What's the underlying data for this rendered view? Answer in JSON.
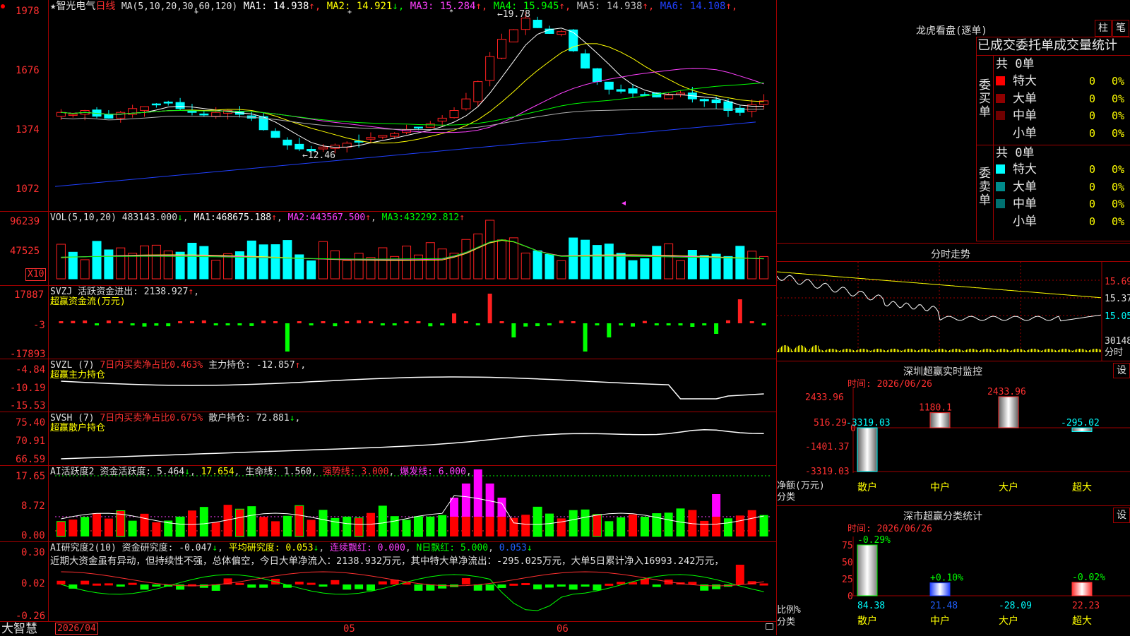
{
  "header": {
    "star": "★",
    "stock_name": "智光电气",
    "period": "日线",
    "ma_params": "MA(5,10,20,30,60,120)",
    "ma": [
      {
        "label": "MA1:",
        "value": "14.938",
        "arrow": "↑",
        "color": "#ffffff"
      },
      {
        "label": "MA2:",
        "value": "14.921",
        "arrow": "↓",
        "color": "#ffff00"
      },
      {
        "label": "MA3:",
        "value": "15.284",
        "arrow": "↑",
        "color": "#ff40ff"
      },
      {
        "label": "MA4:",
        "value": "15.945",
        "arrow": "↑",
        "color": "#00ff00"
      },
      {
        "label": "MA5:",
        "value": "14.938",
        "arrow": "↑",
        "color": "#c0c0c0"
      },
      {
        "label": "MA6:",
        "value": "14.108",
        "arrow": "↑",
        "color": "#2040ff"
      }
    ]
  },
  "price_axis": [
    "1978",
    "1676",
    "1374",
    "1072"
  ],
  "price_annotations": {
    "high": "19.78",
    "low": "12.46"
  },
  "vol": {
    "params": "VOL(5,10,20)",
    "value": "483143.000",
    "value_arrow": "↓",
    "ma1_label": "MA1:",
    "ma1": "468675.188",
    "ma1_arrow": "↑",
    "ma2_label": "MA2:",
    "ma2": "443567.500",
    "ma2_arrow": "↑",
    "ma3_label": "MA3:",
    "ma3": "432292.812",
    "ma3_arrow": "↑",
    "axis": [
      "96239",
      "47525"
    ],
    "unit": "X10"
  },
  "svzj": {
    "name": "SVZJ",
    "label": "活跃资金进出:",
    "value": "2138.927",
    "arrow": "↑",
    "subtitle": "超赢资金流(万元)",
    "axis": [
      "17887",
      "-3",
      "-17893"
    ]
  },
  "svzl": {
    "name": "SVZL (7)",
    "desc": "7日内买卖净占比0.463%",
    "label": "主力持仓:",
    "value": "-12.857",
    "arrow": "↑",
    "tail": ",",
    "subtitle": "超赢主力持仓",
    "axis": [
      "-4.84",
      "-10.19",
      "-15.53"
    ]
  },
  "svsh": {
    "name": "SVSH (7)",
    "desc": "7日内买卖净占比0.675%",
    "label": "散户持仓:",
    "value": "72.881",
    "arrow": "↓",
    "tail": ",",
    "subtitle": "超赢散户持仓",
    "axis": [
      "75.40",
      "70.91",
      "66.59"
    ]
  },
  "ai_active": {
    "name": "AI活跃度2",
    "label": "资金活跃度:",
    "value": "5.464",
    "v2": "17.654",
    "life_label": "生命线:",
    "life": "1.560",
    "strong": "强势线: 3.000",
    "burst": "爆发线: 6.000",
    "axis": [
      "17.65",
      "8.72",
      "0.00"
    ]
  },
  "ai_research": {
    "name": "AI研究度2(10)",
    "label": "资金研究度:",
    "value": "-0.047",
    "avg": "平均研究度: 0.053",
    "lianxu": "连续飘红: 0.000",
    "nday": "N日飘红: 5.000",
    "last": "0.053",
    "comment": "近期大资金虽有异动，但持续性不强，总体偏空，今日大单净流入：2138.932万元，其中特大单净流出：-295.025万元，大单5日累计净入16993.242万元，",
    "axis": [
      "0.30",
      "0.02",
      "-0.26"
    ]
  },
  "date_axis": {
    "brand": "大智慧",
    "start": "2026/04",
    "m05": "05",
    "m06": "06"
  },
  "right": {
    "lhb_title": "龙虎看盘(逐单)",
    "btn_zhu": "柱",
    "btn_bi": "笔",
    "stats_title": "已成交委托单成交量统计",
    "buy_label": "委买单",
    "sell_label": "委卖单",
    "total": "共 0单",
    "buy_rows": [
      {
        "name": "特大",
        "count": "0",
        "pct": "0%",
        "color": "#ff0000"
      },
      {
        "name": "大单",
        "count": "0",
        "pct": "0%",
        "color": "#900000"
      },
      {
        "name": "中单",
        "count": "0",
        "pct": "0%",
        "color": "#700000"
      },
      {
        "name": "小单",
        "count": "0",
        "pct": "0%",
        "color": ""
      }
    ],
    "sell_rows": [
      {
        "name": "特大",
        "count": "0",
        "pct": "0%",
        "color": "#00ffff"
      },
      {
        "name": "大单",
        "count": "0",
        "pct": "0%",
        "color": "#008b8b"
      },
      {
        "name": "中单",
        "count": "0",
        "pct": "0%",
        "color": "#007070"
      },
      {
        "name": "小单",
        "count": "0",
        "pct": "0%",
        "color": ""
      }
    ],
    "intraday_title": "分时走势",
    "intraday_axis": [
      "15.69",
      "15.37",
      "15.05",
      "30148",
      "分时"
    ],
    "sz_monitor_title": "深圳超赢实时监控",
    "sz_set": "设",
    "sz_time": "时间: 2026/06/26",
    "sz_axis": [
      "2433.96",
      "516.29",
      "0",
      "-1401.37",
      "-3319.03"
    ],
    "sz_ylabel": "净额(万元)",
    "sz_xlabel": "分类",
    "sz_bars": [
      {
        "cat": "散户",
        "value": "-3319.03"
      },
      {
        "cat": "中户",
        "value": "1180.1"
      },
      {
        "cat": "大户",
        "value": "2433.96"
      },
      {
        "cat": "超大",
        "value": "-295.02"
      }
    ],
    "cls_title": "深市超赢分类统计",
    "cls_set": "设",
    "cls_time": "时间: 2026/06/26",
    "cls_axis": [
      "75",
      "50",
      "25",
      "0"
    ],
    "cls_ylabel": "比例%",
    "cls_xlabel": "分类",
    "cls_bars": [
      {
        "cat": "散户",
        "top": "-0.29%",
        "bottom": "84.38"
      },
      {
        "cat": "中户",
        "top": "+0.10%",
        "bottom": "21.48"
      },
      {
        "cat": "大户",
        "top": "",
        "bottom": "-28.09"
      },
      {
        "cat": "超大",
        "top": "-0.02%",
        "bottom": "22.23"
      }
    ]
  },
  "colors": {
    "up": "#ff2020",
    "down": "#00ffff",
    "grid": "#a00000",
    "ma1": "#ffffff",
    "ma2": "#ffff00",
    "ma3": "#ff40ff",
    "ma4": "#00ff00",
    "ma6": "#2040ff"
  }
}
